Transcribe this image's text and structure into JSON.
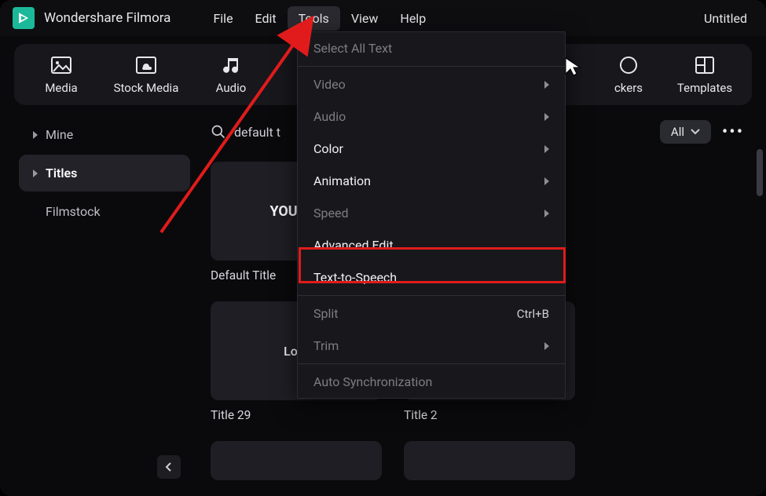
{
  "titlebar": {
    "app_name": "Wondershare Filmora",
    "doc_title": "Untitled"
  },
  "menubar": {
    "items": [
      "File",
      "Edit",
      "Tools",
      "View",
      "Help"
    ],
    "active_index": 2
  },
  "tabs": [
    {
      "label": "Media",
      "icon": "image-icon"
    },
    {
      "label": "Stock Media",
      "icon": "cloud-image-icon"
    },
    {
      "label": "Audio",
      "icon": "music-note-icon"
    },
    {
      "label": "ckers",
      "full_label": "Stickers",
      "icon": "stickers-icon"
    },
    {
      "label": "Templates",
      "icon": "templates-icon"
    }
  ],
  "sidebar": {
    "items": [
      {
        "label": "Mine",
        "expandable": true,
        "active": false
      },
      {
        "label": "Titles",
        "expandable": true,
        "active": true
      },
      {
        "label": "Filmstock",
        "expandable": false,
        "active": false
      }
    ]
  },
  "search": {
    "text": "default t",
    "icon": "search-icon"
  },
  "filter": {
    "label": "All"
  },
  "cards": [
    {
      "thumb_text": "YOUR TI",
      "label": "Default Title"
    },
    {
      "thumb_text": "Lore",
      "label": "Title 29"
    },
    {
      "thumb_text": "",
      "label": "Title 2"
    }
  ],
  "dropdown": {
    "menu": "Tools",
    "items": [
      {
        "label": "Select All Text",
        "enabled": false
      },
      {
        "label": "Video",
        "submenu": true,
        "enabled": false
      },
      {
        "label": "Audio",
        "submenu": true,
        "enabled": false
      },
      {
        "label": "Color",
        "submenu": true,
        "enabled": true
      },
      {
        "label": "Animation",
        "submenu": true,
        "enabled": true
      },
      {
        "label": "Speed",
        "submenu": true,
        "enabled": false
      },
      {
        "label": "Advanced Edit",
        "enabled": true
      },
      {
        "label": "Text-to-Speech",
        "enabled": true,
        "highlighted": true
      },
      {
        "label": "Split",
        "shortcut": "Ctrl+B",
        "enabled": false
      },
      {
        "label": "Trim",
        "submenu": true,
        "enabled": false
      },
      {
        "label": "Auto Synchronization",
        "enabled": false
      }
    ]
  },
  "annotation": {
    "arrow_color": "#e11b1b",
    "highlight_target": "Text-to-Speech"
  },
  "colors": {
    "accent": "#1bb99a",
    "highlight": "#e11b1b",
    "bg": "#0a0a0c",
    "panel": "#17171c"
  }
}
